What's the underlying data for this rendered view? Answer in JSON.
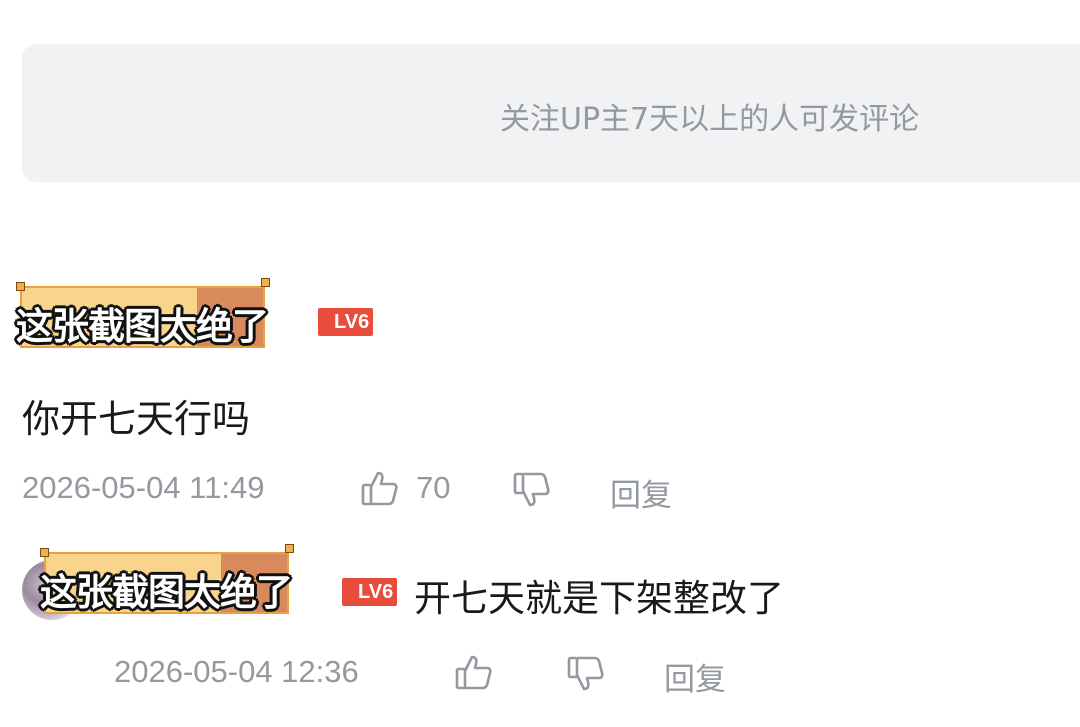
{
  "comment_input": {
    "placeholder": "关注UP主7天以上的人可发评论"
  },
  "comments": [
    {
      "username_overlay": "这张截图太绝了",
      "level": "LV6",
      "text": "你开七天行吗",
      "time": "2026-05-04 11:49",
      "likes": "70",
      "reply_label": "回复"
    },
    {
      "username_overlay": "这张截图太绝了",
      "level": "LV6",
      "text": "开七天就是下架整改了",
      "time": "2026-05-04 12:36",
      "likes": "",
      "reply_label": "回复"
    }
  ],
  "colors": {
    "badge": "#e84c3d",
    "muted": "#9499a0",
    "text": "#18191c",
    "sticker_left": "#f8d48c",
    "sticker_right": "#d98a5c"
  },
  "icons": [
    "thumbs-up-icon",
    "thumbs-down-icon"
  ]
}
